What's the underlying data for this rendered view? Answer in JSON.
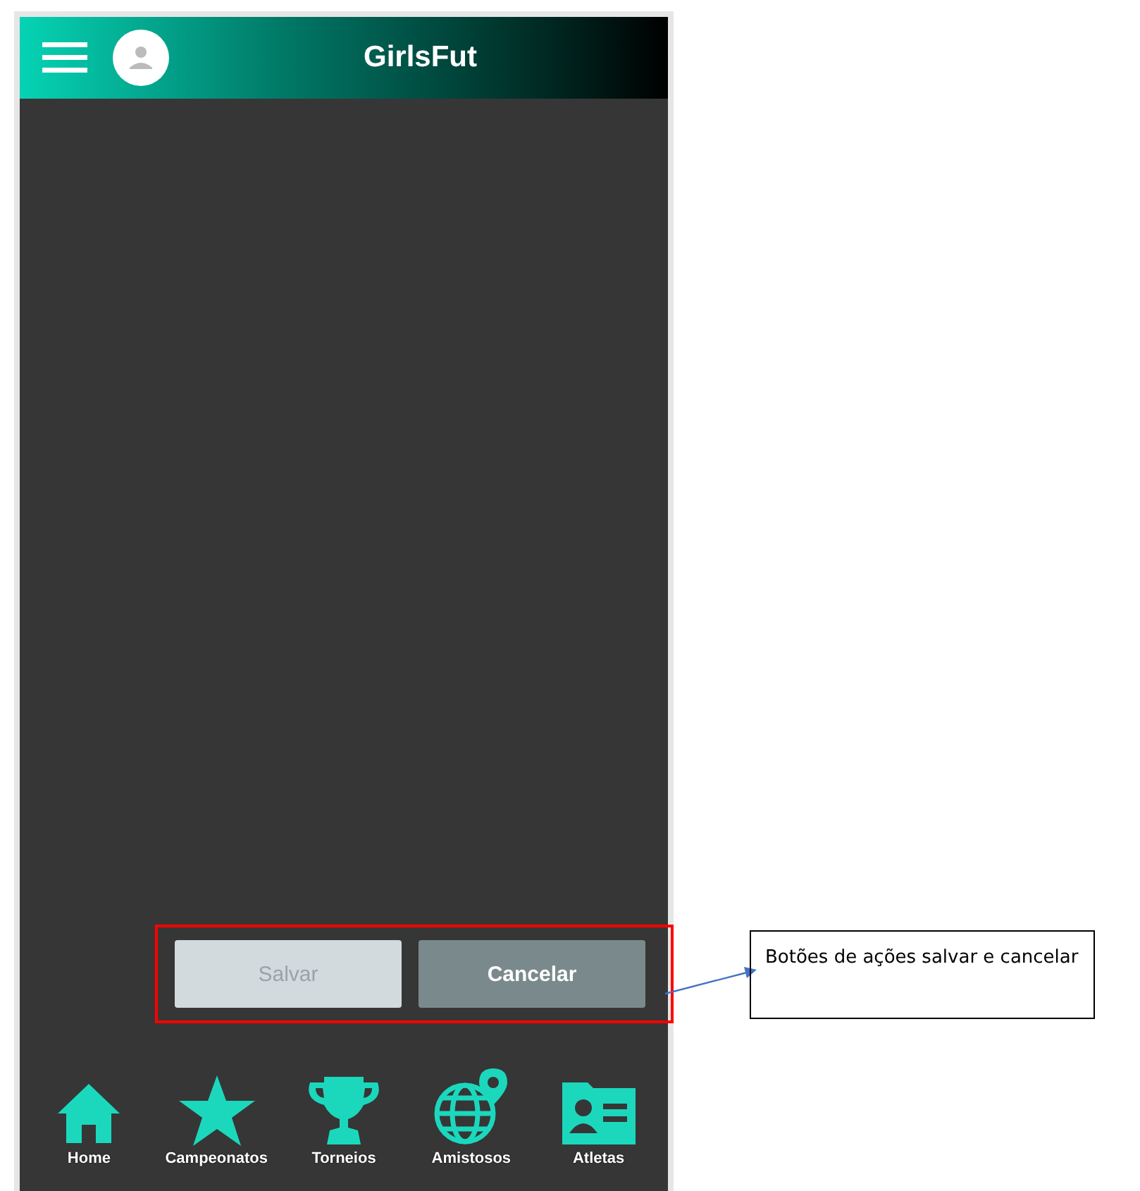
{
  "header": {
    "title": "GirlsFut"
  },
  "actions": [
    {
      "label": "Salvar",
      "disabled": true
    },
    {
      "label": "Cancelar",
      "disabled": false
    }
  ],
  "nav": [
    {
      "label": "Home",
      "kind": "home"
    },
    {
      "label": "Campeonatos",
      "kind": "star"
    },
    {
      "label": "Torneios",
      "kind": "trophy"
    },
    {
      "label": "Amistosos",
      "kind": "globe"
    },
    {
      "label": "Atletas",
      "kind": "card"
    }
  ],
  "annotation": {
    "text": "Botões de ações salvar e cancelar"
  }
}
